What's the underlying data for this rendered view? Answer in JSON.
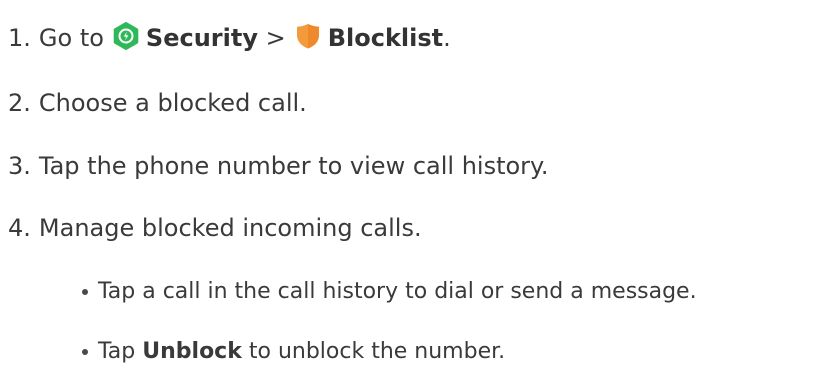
{
  "steps": [
    {
      "number": "1.",
      "go_to": "Go to",
      "security_icon": "security-app-icon",
      "security_label": "Security",
      "separator": ">",
      "blocklist_icon": "shield-icon",
      "blocklist_label": "Blocklist",
      "end": "."
    },
    {
      "number": "2.",
      "text": "Choose a blocked call."
    },
    {
      "number": "3.",
      "text": "Tap the phone number to view call history."
    },
    {
      "number": "4.",
      "text": "Manage blocked incoming calls."
    }
  ],
  "sub_steps": [
    {
      "text": "Tap a call in the call history to dial or send a message."
    },
    {
      "before": "Tap",
      "bold": "Unblock",
      "after": "to unblock the number."
    }
  ],
  "colors": {
    "security_icon": "#2fb85a",
    "blocklist_icon": "#f39a3c"
  }
}
